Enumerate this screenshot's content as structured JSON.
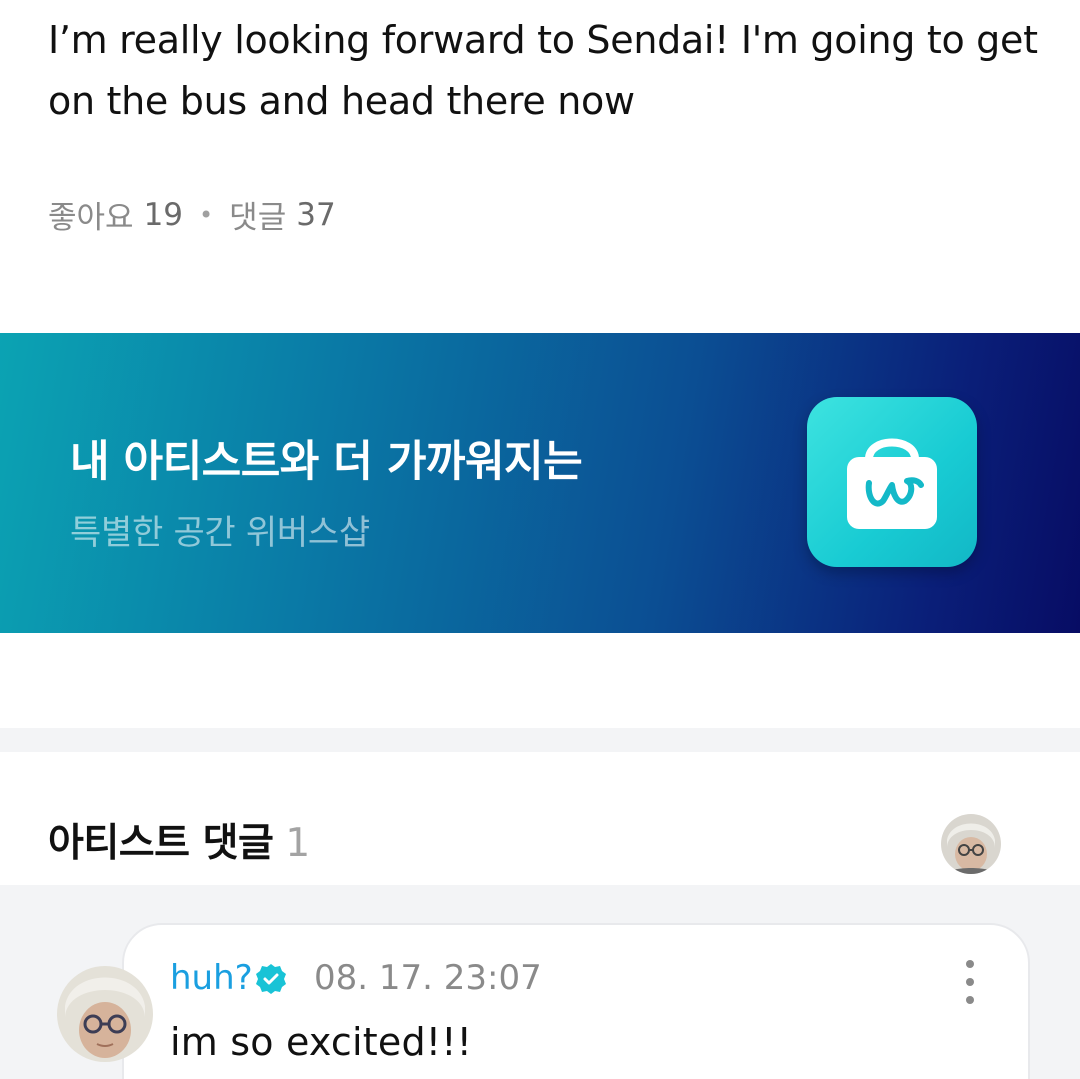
{
  "post": {
    "text": "I’m really looking forward to Sendai! I'm going to get on the bus and head there now",
    "likes_label": "좋아요",
    "likes_count": "19",
    "comments_label": "댓글",
    "comments_count": "37"
  },
  "banner": {
    "title": "내 아티스트와 더 가까워지는",
    "subtitle": "특별한 공간 위버스샵",
    "icon": "weverse-shop-bag-icon"
  },
  "artist_comments": {
    "title": "아티스트 댓글",
    "count": "1"
  },
  "comment": {
    "author": "huh?",
    "verified_icon": "verified-badge-icon",
    "timestamp": "08. 17. 23:07",
    "text": "im so excited!!!"
  },
  "colors": {
    "author": "#1a9fe0",
    "verified": "#19c3d6",
    "banner_start": "#0ba3b3",
    "banner_end": "#070c64"
  }
}
